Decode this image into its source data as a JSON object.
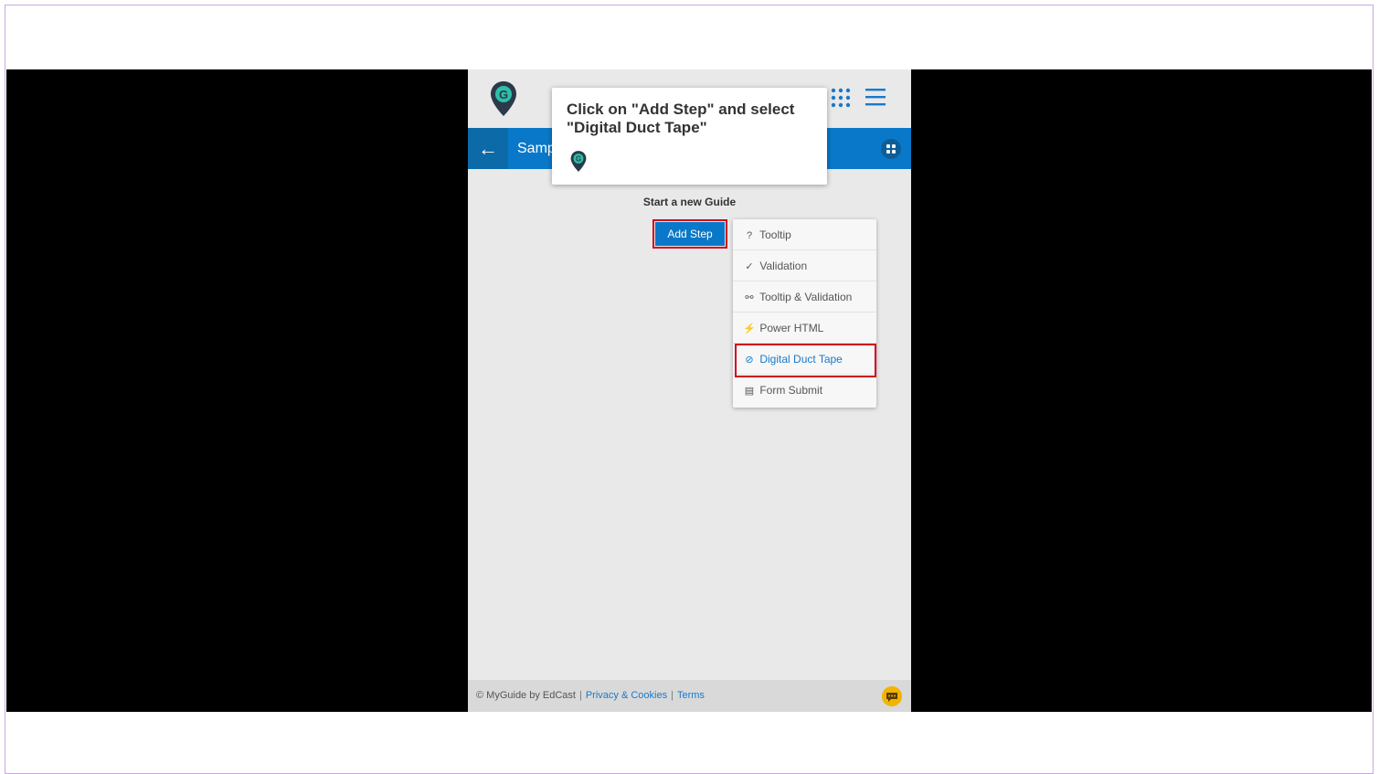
{
  "app": {
    "nav_title": "Samp",
    "back_glyph": "←",
    "start_label": "Start a new Guide",
    "add_step_label": "Add Step",
    "logo_letter": "G"
  },
  "menu": {
    "items": [
      {
        "icon": "question-circle-icon",
        "glyph": "?",
        "label": "Tooltip"
      },
      {
        "icon": "chat-check-icon",
        "glyph": "✓",
        "label": "Validation"
      },
      {
        "icon": "link-icon",
        "glyph": "⚯",
        "label": "Tooltip & Validation"
      },
      {
        "icon": "lightning-icon",
        "glyph": "⚡",
        "label": "Power HTML"
      },
      {
        "icon": "eye-slash-icon",
        "glyph": "⊘",
        "label": "Digital Duct Tape"
      },
      {
        "icon": "form-icon",
        "glyph": "▤",
        "label": "Form Submit"
      }
    ]
  },
  "tooltip": {
    "text": "Click on \"Add Step\" and select\n\"Digital Duct Tape\""
  },
  "footer": {
    "copyright": "© MyGuide by EdCast",
    "privacy": "Privacy & Cookies",
    "terms": "Terms",
    "separator": "|"
  },
  "colors": {
    "primary": "#0a78c8",
    "highlight": "#d0021b",
    "logo_teal": "#2cc0a8",
    "logo_dark": "#2b3a4a",
    "chat_yellow": "#f3b400"
  }
}
